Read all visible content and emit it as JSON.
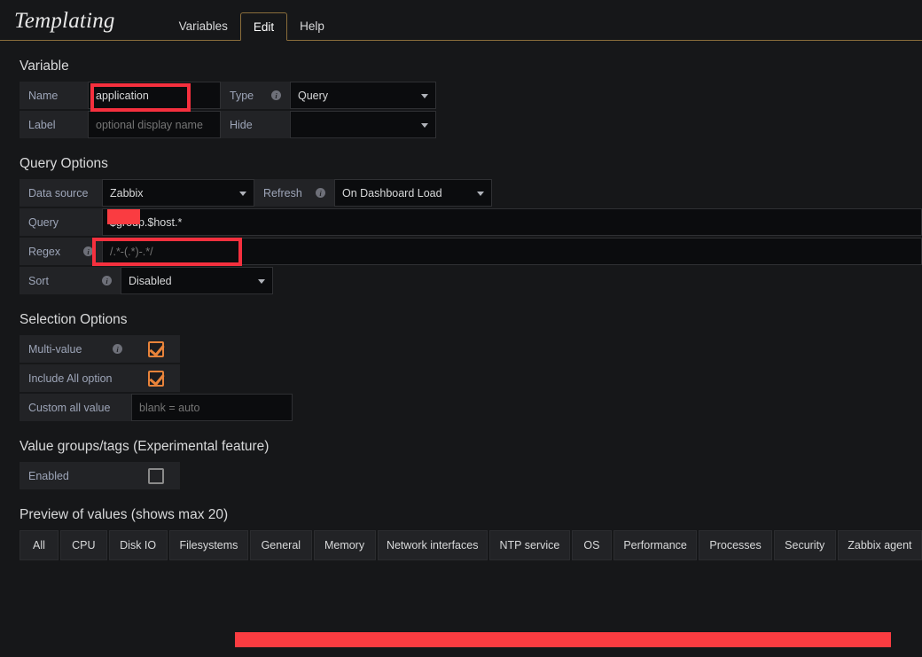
{
  "header": {
    "title": "Templating",
    "tabs": [
      {
        "label": "Variables",
        "active": false
      },
      {
        "label": "Edit",
        "active": true
      },
      {
        "label": "Help",
        "active": false
      }
    ]
  },
  "variable": {
    "section_title": "Variable",
    "name_label": "Name",
    "name_value": "application",
    "type_label": "Type",
    "type_value": "Query",
    "label_label": "Label",
    "label_placeholder": "optional display name",
    "hide_label": "Hide",
    "hide_value": ""
  },
  "query_options": {
    "section_title": "Query Options",
    "datasource_label": "Data source",
    "datasource_value": "Zabbix",
    "refresh_label": "Refresh",
    "refresh_value": "On Dashboard Load",
    "query_label": "Query",
    "query_value": "$group.$host.*",
    "regex_label": "Regex",
    "regex_placeholder": "/.*-(.*)-.*/",
    "sort_label": "Sort",
    "sort_value": "Disabled"
  },
  "selection_options": {
    "section_title": "Selection Options",
    "multivalue_label": "Multi-value",
    "multivalue_checked": true,
    "include_all_label": "Include All option",
    "include_all_checked": true,
    "custom_all_label": "Custom all value",
    "custom_all_placeholder": "blank = auto"
  },
  "value_groups": {
    "section_title": "Value groups/tags (Experimental feature)",
    "enabled_label": "Enabled",
    "enabled_checked": false
  },
  "preview": {
    "section_title": "Preview of values (shows max 20)",
    "values": [
      "All",
      "CPU",
      "Disk IO",
      "Filesystems",
      "General",
      "Memory",
      "Network interfaces",
      "NTP service",
      "OS",
      "Performance",
      "Processes",
      "Security",
      "Zabbix agent"
    ]
  },
  "colors": {
    "accent": "#e8833a",
    "tab_border": "#8a6d3b",
    "redaction": "#fa3c41",
    "background": "#161719",
    "panel": "#222326",
    "input": "#0b0c0e"
  }
}
